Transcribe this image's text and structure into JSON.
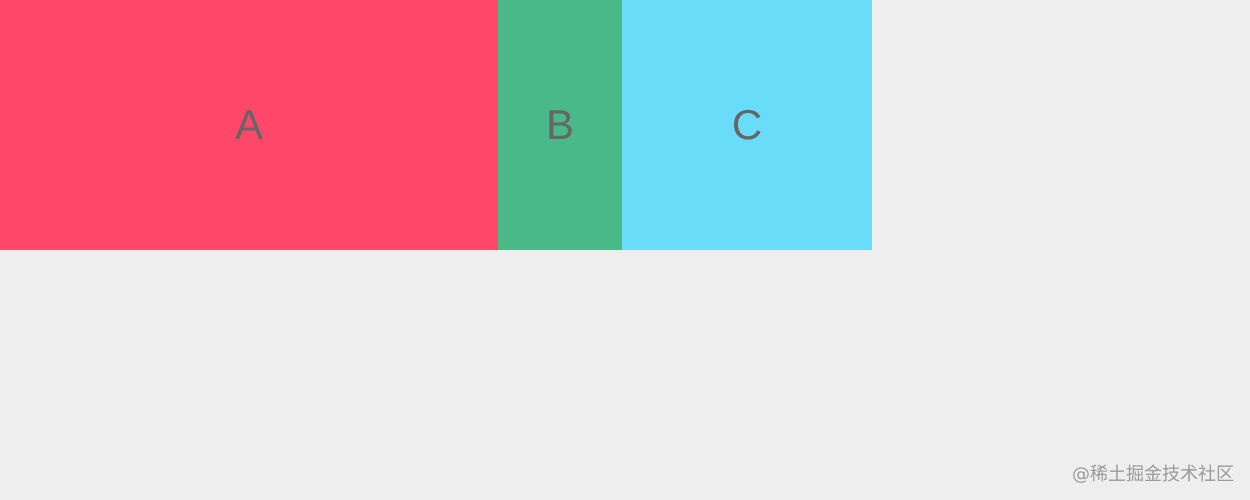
{
  "boxes": [
    {
      "label": "A",
      "color": "#ff4769"
    },
    {
      "label": "B",
      "color": "#48b987"
    },
    {
      "label": "C",
      "color": "#69dcf9"
    }
  ],
  "watermark": "@稀土掘金技术社区",
  "colors": {
    "background": "#eeeeee",
    "label_text": "#666666",
    "watermark_text": "#9a9a9a"
  }
}
